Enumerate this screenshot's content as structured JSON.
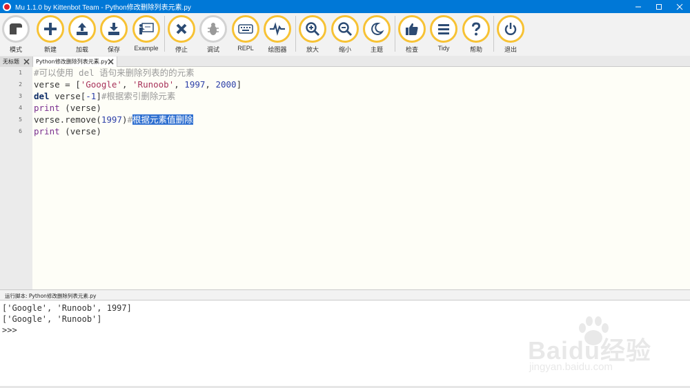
{
  "window": {
    "title": "Mu 1.1.0 by Kittenbot Team - Python修改删除列表元素.py"
  },
  "toolbar": {
    "buttons": [
      {
        "label": "模式",
        "icon": "mode-icon"
      },
      {
        "label": "新建",
        "icon": "plus-icon"
      },
      {
        "label": "加载",
        "icon": "upload-icon"
      },
      {
        "label": "保存",
        "icon": "download-icon"
      },
      {
        "label": "Example",
        "icon": "presentation-icon"
      },
      {
        "label": "停止",
        "icon": "close-icon"
      },
      {
        "label": "调试",
        "icon": "bug-icon"
      },
      {
        "label": "REPL",
        "icon": "keyboard-icon"
      },
      {
        "label": "绘图器",
        "icon": "pulse-icon"
      },
      {
        "label": "放大",
        "icon": "zoom-in-icon"
      },
      {
        "label": "缩小",
        "icon": "zoom-out-icon"
      },
      {
        "label": "主题",
        "icon": "moon-icon"
      },
      {
        "label": "检查",
        "icon": "thumbs-up-icon"
      },
      {
        "label": "Tidy",
        "icon": "tidy-icon"
      },
      {
        "label": "帮助",
        "icon": "question-icon"
      },
      {
        "label": "退出",
        "icon": "power-icon"
      }
    ]
  },
  "tabs": [
    {
      "label": "无标题"
    },
    {
      "label": "Python修改删除列表元素.py"
    }
  ],
  "editor": {
    "lines": [
      {
        "num": "1",
        "tokens": [
          {
            "t": "#可以使用 del 语句来删除列表的的元素",
            "c": "comment"
          }
        ]
      },
      {
        "num": "2",
        "tokens": [
          {
            "t": "verse = [",
            "c": "punc"
          },
          {
            "t": "'Google'",
            "c": "str"
          },
          {
            "t": ", ",
            "c": "punc"
          },
          {
            "t": "'Runoob'",
            "c": "str"
          },
          {
            "t": ", ",
            "c": "punc"
          },
          {
            "t": "1997",
            "c": "num"
          },
          {
            "t": ", ",
            "c": "punc"
          },
          {
            "t": "2000",
            "c": "num"
          },
          {
            "t": "]",
            "c": "punc"
          }
        ]
      },
      {
        "num": "3",
        "tokens": [
          {
            "t": "del",
            "c": "kw"
          },
          {
            "t": " verse[",
            "c": "punc"
          },
          {
            "t": "-1",
            "c": "num"
          },
          {
            "t": "]",
            "c": "punc"
          },
          {
            "t": "#根据索引删除元素",
            "c": "comment"
          }
        ]
      },
      {
        "num": "4",
        "tokens": [
          {
            "t": "print",
            "c": "builtin"
          },
          {
            "t": " (verse)",
            "c": "punc"
          }
        ]
      },
      {
        "num": "5",
        "tokens": [
          {
            "t": "verse.remove(",
            "c": "punc"
          },
          {
            "t": "1997",
            "c": "num"
          },
          {
            "t": ")",
            "c": "punc"
          },
          {
            "t": "#",
            "c": "comment"
          },
          {
            "t": "根据元素值删除",
            "c": "sel"
          }
        ]
      },
      {
        "num": "6",
        "tokens": [
          {
            "t": "print",
            "c": "builtin"
          },
          {
            "t": " (verse)",
            "c": "punc"
          }
        ]
      }
    ]
  },
  "output": {
    "title": "运行脚本: Python修改删除列表元素.py",
    "lines": [
      "['Google', 'Runoob', 1997]",
      "['Google', 'Runoob']",
      ">>>"
    ]
  },
  "watermark": {
    "text": "Baidu经验",
    "sub": "jingyan.baidu.com"
  },
  "colors": {
    "titlebar": "#0078d7",
    "button_ring": "#f7c234",
    "icon": "#2c4b74",
    "selection": "#2e6fd0"
  }
}
